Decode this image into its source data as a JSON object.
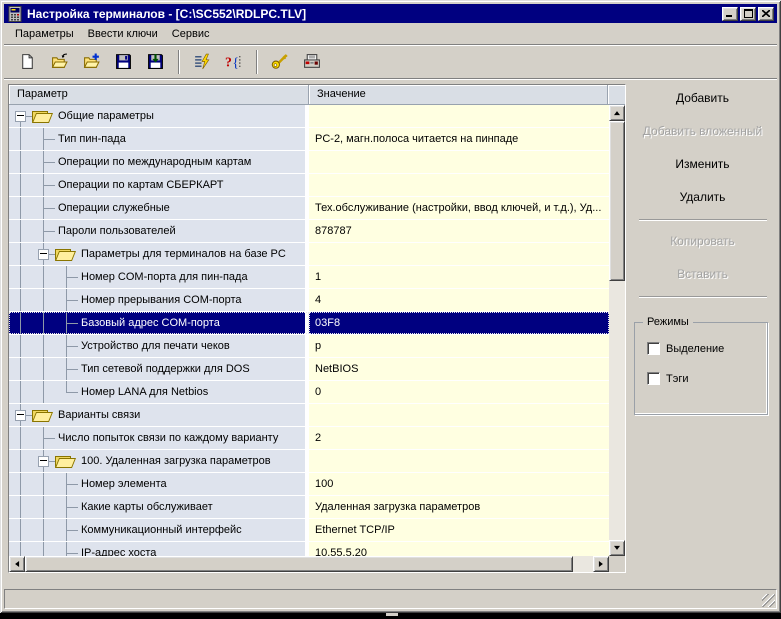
{
  "window": {
    "title": "Настройка терминалов - [C:\\SC552\\RDLPC.TLV]",
    "buttons": [
      "minimize",
      "maximize",
      "close"
    ]
  },
  "menu": {
    "items": [
      "Параметры",
      "Ввести ключи",
      "Сервис"
    ]
  },
  "toolbar": {
    "buttons": [
      {
        "icon": "new-document"
      },
      {
        "icon": "open-file"
      },
      {
        "icon": "open-file-add"
      },
      {
        "icon": "save"
      },
      {
        "icon": "save-import"
      },
      {
        "type": "separator"
      },
      {
        "icon": "apply-list-lightning"
      },
      {
        "icon": "validate-braces"
      },
      {
        "type": "separator"
      },
      {
        "icon": "key"
      },
      {
        "icon": "fiscal-printer"
      }
    ]
  },
  "table": {
    "columns": [
      "Параметр",
      "Значение"
    ],
    "rows": [
      {
        "param": "Общие параметры",
        "value": "",
        "g": [
          "b"
        ],
        "folder": true
      },
      {
        "param": "Тип пин-пада",
        "value": "PC-2, магн.полоса читается на пинпаде",
        "g": [
          "v",
          "t"
        ]
      },
      {
        "param": "Операции по международным картам",
        "value": "",
        "g": [
          "v",
          "t"
        ]
      },
      {
        "param": "Операции по картам СБЕРКАРТ",
        "value": "",
        "g": [
          "v",
          "t"
        ]
      },
      {
        "param": "Операции служебные",
        "value": "Тех.обслуживание (настройки, ввод ключей, и т.д.), Уд...",
        "g": [
          "v",
          "t"
        ]
      },
      {
        "param": "Пароли пользователей",
        "value": "878787",
        "g": [
          "v",
          "t"
        ]
      },
      {
        "param": "Параметры для терминалов на базе PC",
        "value": "",
        "g": [
          "v",
          "vb"
        ],
        "folder": true
      },
      {
        "param": "Номер COM-порта для пин-пада",
        "value": "1",
        "g": [
          "v",
          "v",
          "t"
        ]
      },
      {
        "param": "Номер прерывания COM-порта",
        "value": "4",
        "g": [
          "v",
          "v",
          "t"
        ]
      },
      {
        "param": "Базовый адрес COM-порта",
        "value": "03F8",
        "g": [
          "v",
          "v",
          "t"
        ],
        "selected": true
      },
      {
        "param": "Устройство для печати чеков",
        "value": "p",
        "g": [
          "v",
          "v",
          "t"
        ]
      },
      {
        "param": "Тип сетевой поддержки для DOS",
        "value": "NetBIOS",
        "g": [
          "v",
          "v",
          "t"
        ]
      },
      {
        "param": "Номер LANA для Netbios",
        "value": "0",
        "g": [
          "v",
          "v",
          "l"
        ]
      },
      {
        "param": "Варианты связи",
        "value": "",
        "g": [
          "vb"
        ],
        "folder": true
      },
      {
        "param": "Число попыток связи по каждому варианту",
        "value": "2",
        "g": [
          "v",
          "t"
        ]
      },
      {
        "param": "100. Удаленная загрузка параметров",
        "value": "",
        "g": [
          "v",
          "vb"
        ],
        "folder": true
      },
      {
        "param": "Номер элемента",
        "value": "100",
        "g": [
          "v",
          "v",
          "t"
        ]
      },
      {
        "param": "Какие карты обслуживает",
        "value": "Удаленная загрузка параметров",
        "g": [
          "v",
          "v",
          "t"
        ]
      },
      {
        "param": "Коммуникационный интерфейс",
        "value": "Ethernet TCP/IP",
        "g": [
          "v",
          "v",
          "t"
        ]
      },
      {
        "param": "IP-адрес хоста",
        "value": "10.55.5.20",
        "g": [
          "v",
          "v",
          "t"
        ]
      }
    ]
  },
  "panel": {
    "buttons": [
      {
        "label": "Добавить",
        "enabled": true
      },
      {
        "label": "Добавить вложенный",
        "enabled": false
      },
      {
        "label": "Изменить",
        "enabled": true
      },
      {
        "label": "Удалить",
        "enabled": true
      },
      {
        "type": "separator"
      },
      {
        "label": "Копировать",
        "enabled": false
      },
      {
        "label": "Вставить",
        "enabled": false
      },
      {
        "type": "separator"
      }
    ],
    "modes": {
      "title": "Режимы",
      "checkboxes": [
        {
          "label": "Выделение",
          "checked": false
        },
        {
          "label": "Тэги",
          "checked": false
        }
      ]
    }
  },
  "colors": {
    "titlebar": "#000080",
    "selection": "#000080",
    "param_cell_bg": "#dee3ed",
    "value_cell_bg": "#ffffe1",
    "chrome": "#d4d0c8"
  }
}
